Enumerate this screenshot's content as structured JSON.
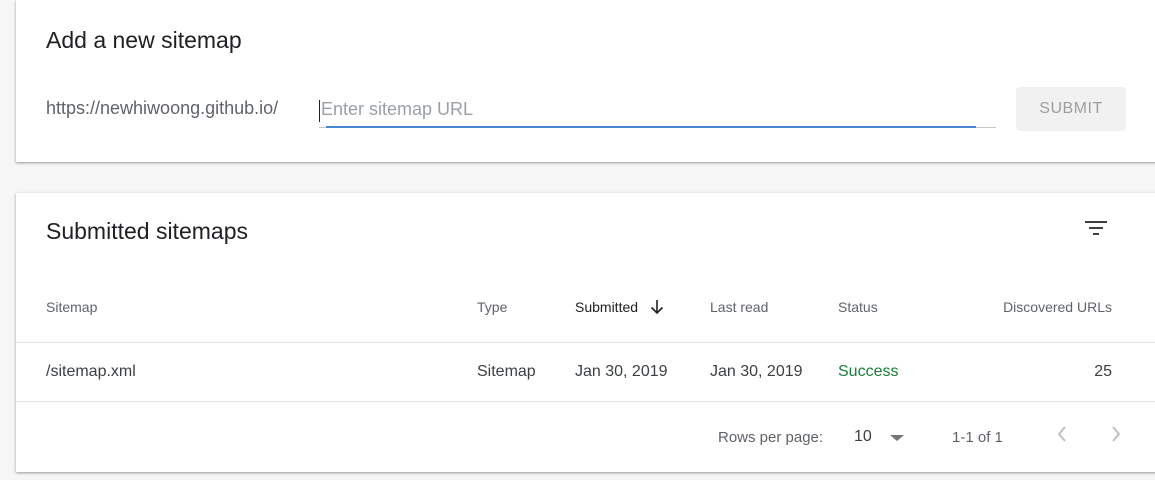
{
  "add_sitemap": {
    "title": "Add a new sitemap",
    "url_prefix": "https://newhiwoong.github.io/",
    "input_value": "",
    "input_placeholder": "Enter sitemap URL",
    "submit_label": "SUBMIT"
  },
  "submitted": {
    "title": "Submitted sitemaps",
    "columns": [
      "Sitemap",
      "Type",
      "Submitted",
      "Last read",
      "Status",
      "Discovered URLs"
    ],
    "rows": [
      {
        "sitemap": "/sitemap.xml",
        "type": "Sitemap",
        "submitted": "Jan 30, 2019",
        "last_read": "Jan 30, 2019",
        "status": "Success",
        "discovered_urls": "25"
      }
    ],
    "pagination": {
      "rows_per_page_label": "Rows per page:",
      "rows_per_page_value": "10",
      "range": "1-1 of 1"
    }
  },
  "colors": {
    "accent": "#4a88d6",
    "success": "#188038"
  },
  "icons": [
    "filter-list-icon",
    "arrow-down-icon",
    "dropdown-triangle-icon",
    "chevron-left-icon",
    "chevron-right-icon"
  ]
}
